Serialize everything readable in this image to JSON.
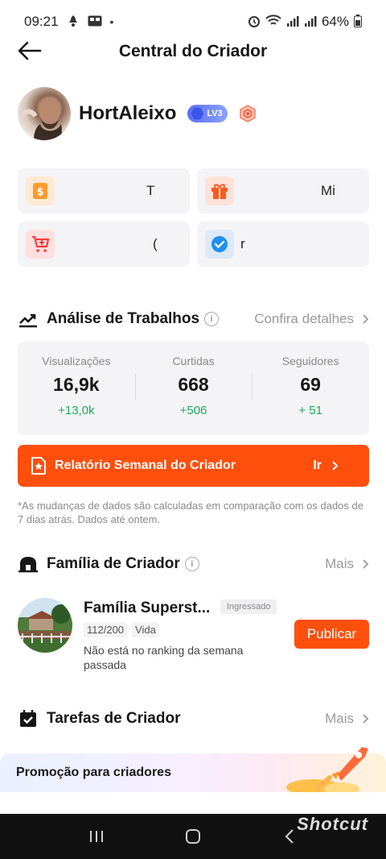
{
  "status_bar": {
    "time": "09:21",
    "battery": "64%"
  },
  "header": {
    "title": "Central do Criador"
  },
  "profile": {
    "username": "HortAleixo",
    "level_badge": "LV3"
  },
  "quick_tiles": [
    {
      "label": "T",
      "icon": "dollar-doc-icon",
      "color": "#ff9a2b"
    },
    {
      "label": "Mi",
      "icon": "gift-icon",
      "color": "#ff5a1f"
    },
    {
      "label": "(",
      "icon": "cart-plus-icon",
      "color": "#ff3b3b"
    },
    {
      "label": "r",
      "icon": "check-circle-icon",
      "color": "#1f8ff0"
    }
  ],
  "analytics": {
    "title": "Análise de Trabalhos",
    "link": "Confira detalhes",
    "stats": [
      {
        "label": "Visualizações",
        "value": "16,9k",
        "delta": "+13,0k"
      },
      {
        "label": "Curtidas",
        "value": "668",
        "delta": "+506"
      },
      {
        "label": "Seguidores",
        "value": "69",
        "delta": "+ 51"
      }
    ]
  },
  "report": {
    "label": "Relatório Semanal do Criador",
    "action": "Ir"
  },
  "note": "*As mudanças de dados são calculadas em comparação com os dados de 7 dias atrás. Dados até ontem.",
  "family": {
    "section_title": "Família de Criador",
    "link": "Mais",
    "name": "Família Superst...",
    "joined": "Ingressado",
    "members": "112/200",
    "type": "Vida",
    "status": "Não está no ranking da semana passada",
    "publish": "Publicar"
  },
  "tasks": {
    "section_title": "Tarefas de Criador",
    "link": "Mais"
  },
  "promo": {
    "label": "Promoção para criadores"
  },
  "watermark": "Shotcut",
  "colors": {
    "accent": "#ff4f0d",
    "positive": "#1aae58"
  }
}
